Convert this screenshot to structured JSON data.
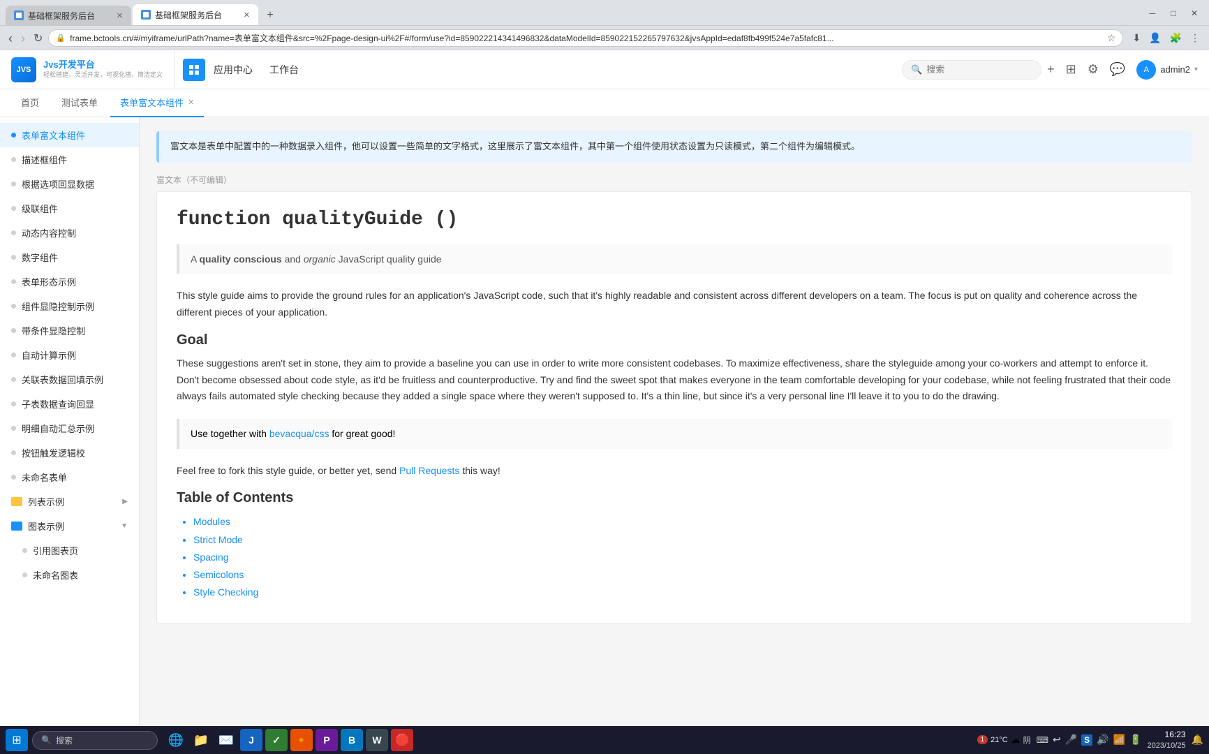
{
  "browser": {
    "tabs": [
      {
        "id": "tab1",
        "label": "基础框架服务后台",
        "active": false,
        "icon": "🏠"
      },
      {
        "id": "tab2",
        "label": "基础框架服务后台",
        "active": true,
        "icon": "🏠"
      }
    ],
    "url": "frame.bctools.cn/#/myiframe/urlPath?name=表单富文本组件&src=%2Fpage-design-ui%2F#/form/use?id=859022214341496832&dataModelId=859022152265797632&jvsAppId=edaf8fb499f524e7a5fafc81...",
    "nav_back": "‹",
    "nav_forward": "›",
    "nav_refresh": "↻",
    "nav_home": "⌂"
  },
  "app": {
    "logo_text": "Jvs开发平台",
    "logo_sub": "轻松搭建，灵活开发，可视化搭，简洁定义",
    "nav_items": [
      "应用中心",
      "工作台"
    ],
    "search_placeholder": "搜索",
    "user": "admin2",
    "header_menu_icon": "⋮⋮",
    "plus_icon": "+",
    "grid_icon": "⊞",
    "settings_icon": "⚙",
    "chat_icon": "💬"
  },
  "breadcrumb": {
    "tabs": [
      {
        "label": "首页",
        "active": false
      },
      {
        "label": "测试表单",
        "active": false
      },
      {
        "label": "表单富文本组件",
        "active": true
      }
    ]
  },
  "sidebar": {
    "items": [
      {
        "label": "表单富文本组件",
        "active": true,
        "type": "item"
      },
      {
        "label": "描述框组件",
        "active": false,
        "type": "item"
      },
      {
        "label": "根据选项回显数据",
        "active": false,
        "type": "item"
      },
      {
        "label": "级联组件",
        "active": false,
        "type": "item"
      },
      {
        "label": "动态内容控制",
        "active": false,
        "type": "item"
      },
      {
        "label": "数字组件",
        "active": false,
        "type": "item"
      },
      {
        "label": "表单形态示例",
        "active": false,
        "type": "item"
      },
      {
        "label": "组件显隐控制示例",
        "active": false,
        "type": "item"
      },
      {
        "label": "带条件显隐控制",
        "active": false,
        "type": "item"
      },
      {
        "label": "自动计算示例",
        "active": false,
        "type": "item"
      },
      {
        "label": "关联表数据回填示例",
        "active": false,
        "type": "item"
      },
      {
        "label": "子表数据查询回显",
        "active": false,
        "type": "item"
      },
      {
        "label": "明细自动汇总示例",
        "active": false,
        "type": "item"
      },
      {
        "label": "按钮触发逻辑校",
        "active": false,
        "type": "item"
      },
      {
        "label": "未命名表单",
        "active": false,
        "type": "item"
      },
      {
        "label": "列表示例",
        "active": false,
        "type": "group",
        "color": "orange"
      },
      {
        "label": "图表示例",
        "active": false,
        "type": "group",
        "color": "blue"
      },
      {
        "label": "引用图表页",
        "active": false,
        "type": "item"
      },
      {
        "label": "未命名图表",
        "active": false,
        "type": "item"
      }
    ]
  },
  "content": {
    "info_banner": "富文本是表单中配置中的一种数据录入组件，他可以设置一些简单的文字格式，这里展示了富文本组件，其中第一个组件使用状态设置为只读模式，第二个组件为编辑模式。",
    "section_label": "富文本（不可编辑）",
    "heading": "function qualityGuide ()",
    "blockquote_text": "A ",
    "blockquote_bold": "quality conscious",
    "blockquote_mid": " and ",
    "blockquote_italic": "organic",
    "blockquote_end": " JavaScript quality guide",
    "body_para1": "This style guide aims to provide the ground rules for an application's JavaScript code, such that it's highly readable and consistent across different developers on a team. The focus is put on quality and coherence across the different pieces of your application.",
    "subheading_goal": "Goal",
    "body_para2": "These suggestions aren't set in stone, they aim to provide a baseline you can use in order to write more consistent codebases. To maximize effectiveness, share the styleguide among your co-workers and attempt to enforce it. Don't become obsessed about code style, as it'd be fruitless and counterproductive. Try and find the sweet spot that makes everyone in the team comfortable developing for your codebase, while not feeling frustrated that their code always fails automated style checking because they added a single space where they weren't supposed to. It's a thin line, but since it's a very personal line I'll leave it to you to do the drawing.",
    "blockquote2_pre": "Use together with ",
    "blockquote2_link": "bevacqua/css",
    "blockquote2_link_href": "https://github.com/bevacqua/css",
    "blockquote2_post": " for great good!",
    "body_para3_pre": "Feel free to fork this style guide, or better yet, send ",
    "body_para3_link": "Pull Requests",
    "body_para3_post": " this way!",
    "toc_heading": "Table of Contents",
    "toc_items": [
      {
        "label": "Modules",
        "href": "#modules"
      },
      {
        "label": "Strict Mode",
        "href": "#strict-mode"
      },
      {
        "label": "Spacing",
        "href": "#spacing"
      },
      {
        "label": "Semicolons",
        "href": "#semicolons"
      },
      {
        "label": "Style Checking",
        "href": "#style-checking"
      }
    ]
  },
  "taskbar": {
    "start_icon": "⊞",
    "search_placeholder": "搜索",
    "time": "16:23",
    "date": "2023/10/25",
    "temp": "21°C",
    "location": "阴",
    "notification_badge": "1"
  }
}
